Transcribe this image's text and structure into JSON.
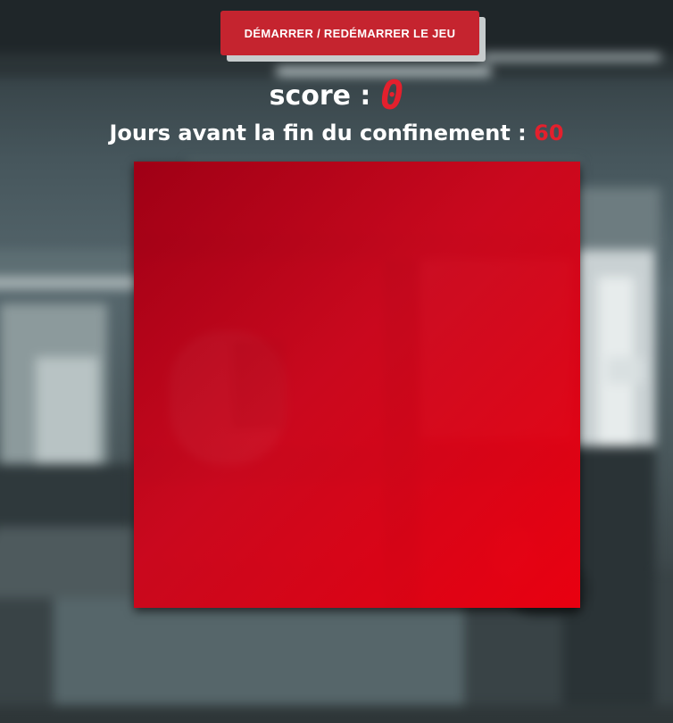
{
  "controls": {
    "start_button_label": "DÉMARRER / REDÉMARRER LE JEU"
  },
  "score": {
    "label": "score :",
    "value": "0"
  },
  "countdown": {
    "label": "Jours avant la fin du confinement :",
    "value": "60"
  },
  "colors": {
    "accent": "#e4202d",
    "button": "#c5242f",
    "board": "#d1001c"
  }
}
